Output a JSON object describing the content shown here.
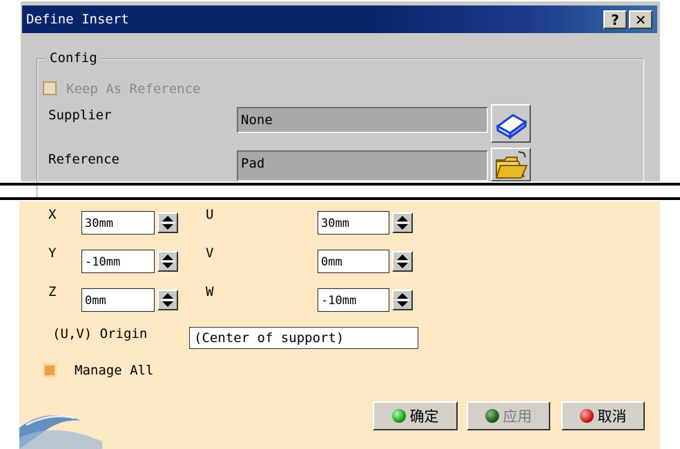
{
  "window": {
    "title": "Define Insert",
    "help_label": "?",
    "close_label": "✕"
  },
  "config": {
    "group_label": "Config",
    "keep_as_reference": {
      "label": "Keep As Reference",
      "checked": false
    },
    "supplier": {
      "label": "Supplier",
      "value": "None"
    },
    "reference": {
      "label": "Reference",
      "value": "Pad"
    }
  },
  "position": {
    "x": {
      "label": "X",
      "value": "30mm"
    },
    "y": {
      "label": "Y",
      "value": "-10mm"
    },
    "z": {
      "label": "Z",
      "value": "0mm"
    },
    "u": {
      "label": "U",
      "value": "30mm"
    },
    "v": {
      "label": "V",
      "value": "0mm"
    },
    "w": {
      "label": "W",
      "value": "-10mm"
    },
    "origin": {
      "label": "(U,V) Origin",
      "value": "(Center of support)"
    }
  },
  "manage_all": {
    "label": "Manage All",
    "checked": true
  },
  "buttons": {
    "ok": {
      "label": "确定",
      "led_color": "#1aa01a"
    },
    "apply": {
      "label": "应用",
      "led_color": "#1f5f1f"
    },
    "cancel": {
      "label": "取消",
      "led_color": "#d01818"
    }
  }
}
